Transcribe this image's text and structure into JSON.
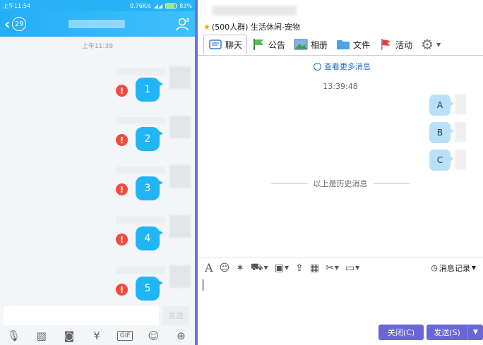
{
  "phone": {
    "status": {
      "time": "上午11:54",
      "speed": "0.76K/s",
      "battery": "83%"
    },
    "unread_count": "29",
    "time_divider": "上午11:39",
    "messages": [
      {
        "text": "1",
        "error_icon": "!"
      },
      {
        "text": "2",
        "error_icon": "!"
      },
      {
        "text": "3",
        "error_icon": "!"
      },
      {
        "text": "4",
        "error_icon": "!"
      },
      {
        "text": "5",
        "error_icon": "!"
      }
    ],
    "send_label": "发送",
    "toolbar_icons": [
      "mic-icon",
      "image-icon",
      "camera-icon",
      "red-packet-icon",
      "gif-icon",
      "emoji-icon",
      "plus-icon"
    ]
  },
  "desktop": {
    "group_name": "(500人群) 生活休闲-宠物",
    "tabs": [
      {
        "label": "聊天",
        "icon": "chat-icon"
      },
      {
        "label": "公告",
        "icon": "announcement-icon"
      },
      {
        "label": "相册",
        "icon": "album-icon"
      },
      {
        "label": "文件",
        "icon": "folder-icon"
      },
      {
        "label": "活动",
        "icon": "flag-icon"
      }
    ],
    "more_messages": "查看更多消息",
    "time_divider": "13:39:48",
    "messages": [
      "A",
      "B",
      "C"
    ],
    "history_divider": "以上是历史消息",
    "history_button": "消息记录",
    "close_label": "关闭(C)",
    "send_label": "发送(S)",
    "colors": {
      "accent": "#6a66d6",
      "bubble": "#b8e0fb",
      "phone_header": "#28b2f8",
      "error": "#f04c3d"
    }
  }
}
